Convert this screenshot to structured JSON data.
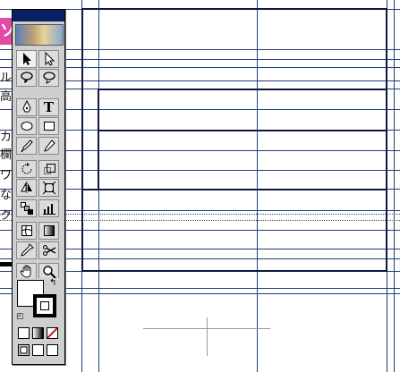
{
  "page_text": {
    "logo_char": "ソ",
    "lines": [
      "ル",
      "高",
      "カ",
      "欄",
      "ワ",
      "な",
      "ク"
    ]
  },
  "toolbox": {
    "tools": [
      {
        "name": "selection-tool",
        "glyph": "selection-arrow-icon"
      },
      {
        "name": "direct-selection-tool",
        "glyph": "direct-selection-arrow-icon"
      },
      {
        "name": "lasso-tool",
        "glyph": "lasso-icon"
      },
      {
        "name": "direct-lasso-tool",
        "glyph": "direct-lasso-icon"
      },
      {
        "name": "pen-tool",
        "glyph": "pen-icon"
      },
      {
        "name": "type-tool",
        "label": "T",
        "glyph": "type-icon"
      },
      {
        "name": "ellipse-tool",
        "glyph": "ellipse-icon"
      },
      {
        "name": "rectangle-tool",
        "glyph": "rectangle-icon"
      },
      {
        "name": "brush-tool",
        "glyph": "brush-icon"
      },
      {
        "name": "pencil-tool",
        "glyph": "pencil-icon"
      },
      {
        "name": "rotate-tool",
        "glyph": "rotate-icon"
      },
      {
        "name": "scale-tool",
        "glyph": "scale-icon"
      },
      {
        "name": "reflect-tool",
        "glyph": "reflect-icon"
      },
      {
        "name": "free-transform-tool",
        "glyph": "free-transform-icon"
      },
      {
        "name": "blend-tool",
        "glyph": "blend-icon"
      },
      {
        "name": "graph-tool",
        "glyph": "graph-icon"
      },
      {
        "name": "gradient-mesh-tool",
        "glyph": "mesh-icon"
      },
      {
        "name": "gradient-tool",
        "glyph": "gradient-icon"
      },
      {
        "name": "eyedropper-tool",
        "glyph": "eyedropper-icon"
      },
      {
        "name": "scissors-tool",
        "glyph": "scissors-icon"
      },
      {
        "name": "hand-tool",
        "glyph": "hand-icon"
      },
      {
        "name": "zoom-tool",
        "glyph": "zoom-icon"
      }
    ]
  },
  "colors": {
    "guide": "#1d3f7a",
    "frame": "#0b1840",
    "titlebar": "#0a2060",
    "logo_pink": "#e24aa8",
    "none_swatch": "#c0162a"
  }
}
